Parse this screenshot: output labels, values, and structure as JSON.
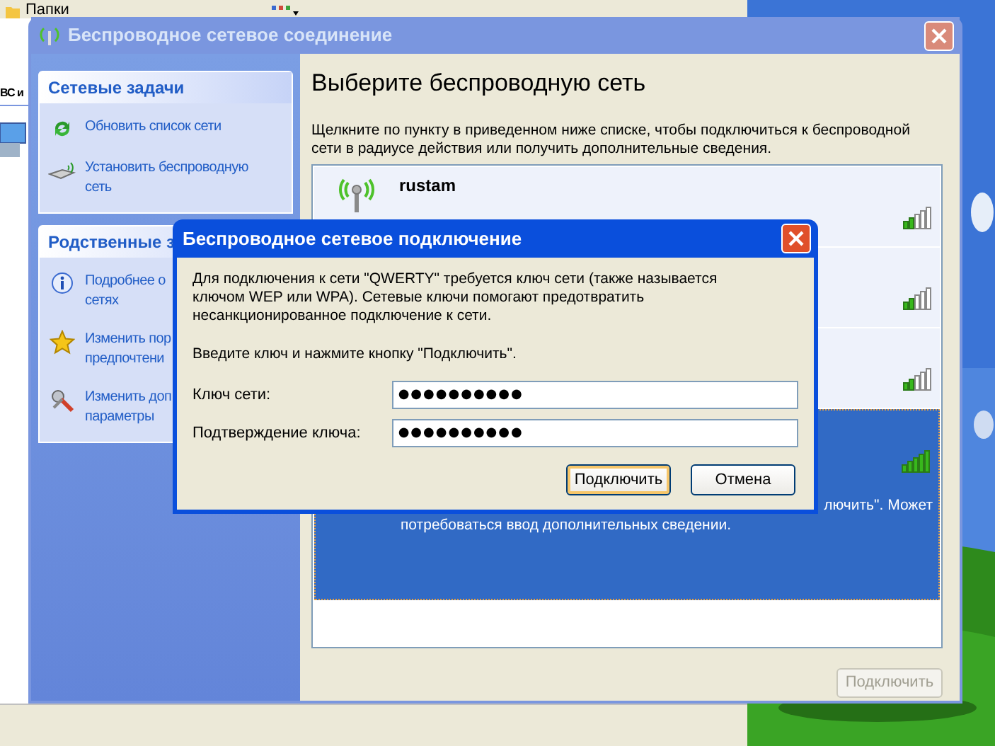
{
  "explorer": {
    "toolbar_label": "Папки",
    "pane_text": "ВС и"
  },
  "window": {
    "title": "Беспроводное сетевое соединение",
    "active": false
  },
  "sidebar": {
    "sections": [
      {
        "title": "Сетевые задачи",
        "items": [
          {
            "kind": "refresh",
            "lines": [
              "Обновить список сети"
            ]
          },
          {
            "kind": "setup",
            "lines": [
              "Установить беспроводную",
              "сеть"
            ]
          }
        ]
      },
      {
        "title": "Родственные з",
        "items": [
          {
            "kind": "info",
            "lines": [
              "Подробнее о",
              "сетях"
            ]
          },
          {
            "kind": "star",
            "lines": [
              "Изменить пор",
              "предпочтени"
            ]
          },
          {
            "kind": "tools",
            "lines": [
              "Изменить доп",
              "параметры"
            ]
          }
        ]
      }
    ]
  },
  "content": {
    "heading": "Выберите беспроводную сеть",
    "instruction": "Щелкните по пункту в приведенном ниже списке, чтобы подключиться к беспроводной сети в радиусе действия или получить дополнительные сведения.",
    "networks": [
      {
        "name": "rustam",
        "level": 0.4,
        "selected": false
      },
      {
        "level": 0.4,
        "selected": false
      },
      {
        "level": 0.4,
        "selected": false
      },
      {
        "level": 1,
        "selected": true,
        "description": [
          "лючить\". Может",
          "потребоваться ввод дополнительных сведении."
        ]
      }
    ],
    "connect_button": {
      "label": "Подключить",
      "disabled": true
    }
  },
  "dialog": {
    "title": "Беспроводное сетевое подключение",
    "active": true,
    "message": "Для подключения к сети \"QWERTY\" требуется ключ сети (также называется ключом WEP или WPA). Сетевые ключи помогают предотвратить несанкционированное подключение к сети.",
    "prompt": "Введите ключ и нажмите кнопку \"Подключить\".",
    "fields": [
      {
        "label": "Ключ сети:",
        "value": "●●●●●●●●●●"
      },
      {
        "label": "Подтверждение ключа:",
        "value": "●●●●●●●●●●"
      }
    ],
    "buttons": [
      {
        "label": "Подключить",
        "default": true
      },
      {
        "label": "Отмена",
        "default": false
      }
    ]
  }
}
